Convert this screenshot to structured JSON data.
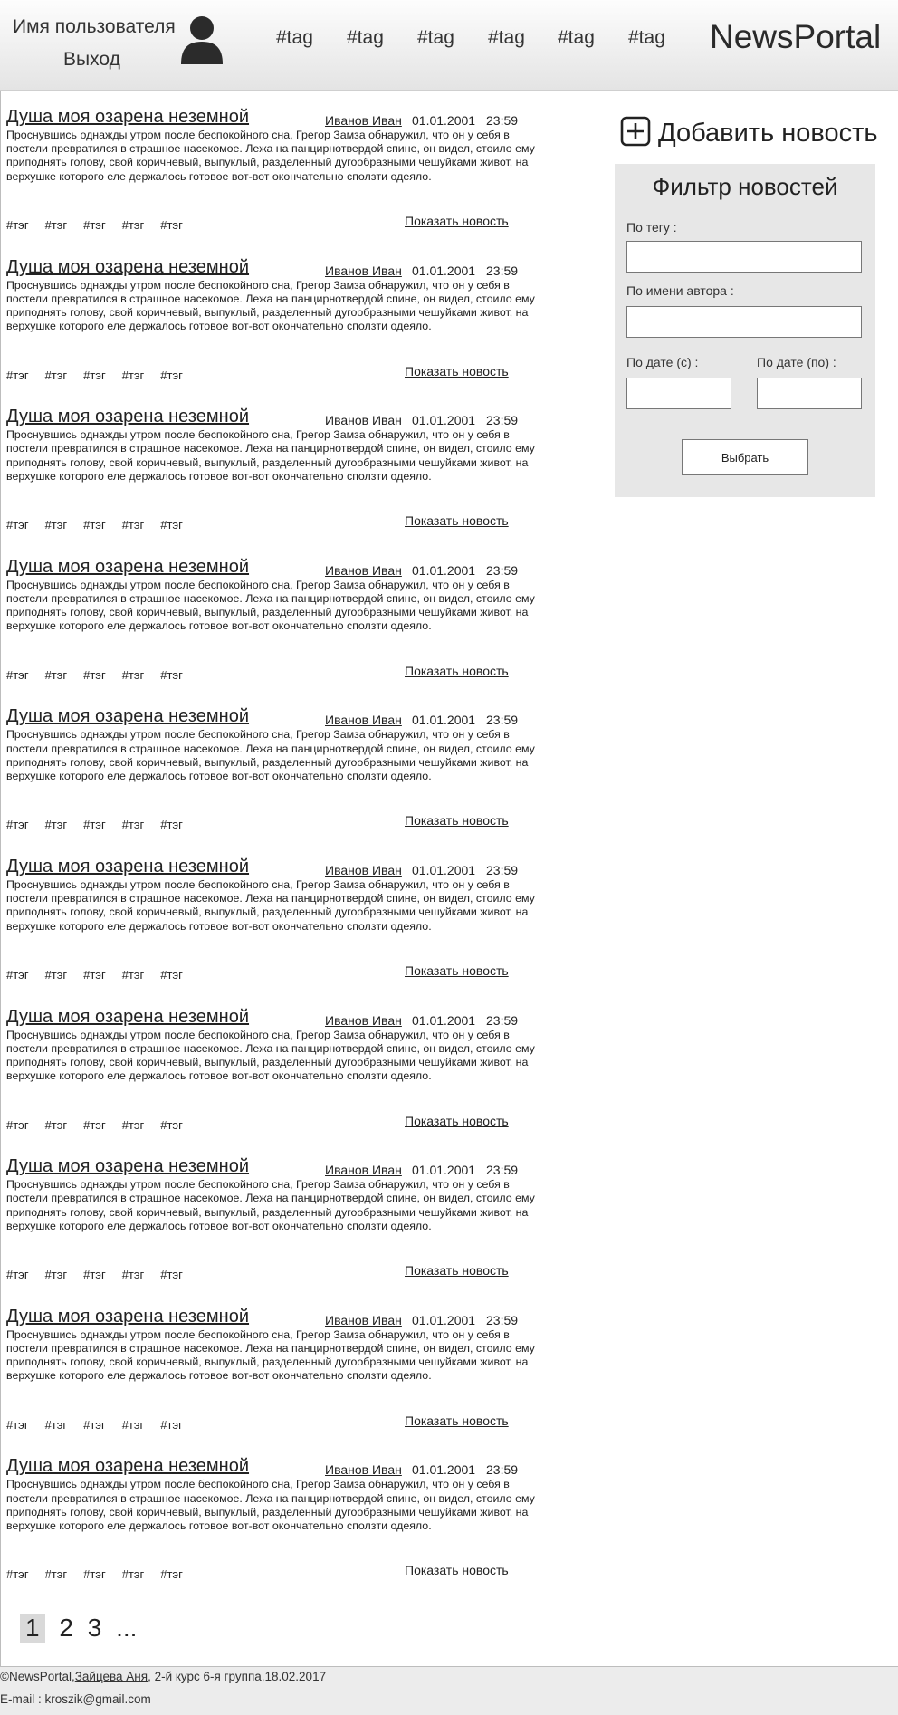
{
  "header": {
    "user_name": "Имя пользователя",
    "logout": "Выход",
    "nav_tags": [
      "#tag",
      "#tag",
      "#tag",
      "#tag",
      "#tag",
      "#tag"
    ],
    "brand": "NewsPortal"
  },
  "news": {
    "items": [
      {
        "title": "Душа моя озарена неземной",
        "author": "Иванов Иван",
        "date": "01.01.2001",
        "time": "23:59",
        "text": "Проснувшись однажды утром после беспокойного сна, Грегор Замза обнаружил, что он у себя в постели превратился в страшное насекомое. Лежа на панцирнотвердой спине, он видел, стоило ему приподнять голову, свой коричневый, выпуклый, разделенный дугообразными чешуйками живот, на верхушке которого еле держалось готовое вот-вот окончательно сползти одеяло.",
        "tags": [
          "#тэг",
          "#тэг",
          "#тэг",
          "#тэг",
          "#тэг"
        ],
        "show": "Показать новость"
      },
      {
        "title": "Душа моя озарена неземной",
        "author": "Иванов Иван",
        "date": "01.01.2001",
        "time": "23:59",
        "text": "Проснувшись однажды утром после беспокойного сна, Грегор Замза обнаружил, что он у себя в постели превратился в страшное насекомое. Лежа на панцирнотвердой спине, он видел, стоило ему приподнять голову, свой коричневый, выпуклый, разделенный дугообразными чешуйками живот, на верхушке которого еле держалось готовое вот-вот окончательно сползти одеяло.",
        "tags": [
          "#тэг",
          "#тэг",
          "#тэг",
          "#тэг",
          "#тэг"
        ],
        "show": "Показать новость"
      },
      {
        "title": "Душа моя озарена неземной",
        "author": "Иванов Иван",
        "date": "01.01.2001",
        "time": "23:59",
        "text": "Проснувшись однажды утром после беспокойного сна, Грегор Замза обнаружил, что он у себя в постели превратился в страшное насекомое. Лежа на панцирнотвердой спине, он видел, стоило ему приподнять голову, свой коричневый, выпуклый, разделенный дугообразными чешуйками живот, на верхушке которого еле держалось готовое вот-вот окончательно сползти одеяло.",
        "tags": [
          "#тэг",
          "#тэг",
          "#тэг",
          "#тэг",
          "#тэг"
        ],
        "show": "Показать новость"
      },
      {
        "title": "Душа моя озарена неземной",
        "author": "Иванов Иван",
        "date": "01.01.2001",
        "time": "23:59",
        "text": "Проснувшись однажды утром после беспокойного сна, Грегор Замза обнаружил, что он у себя в постели превратился в страшное насекомое. Лежа на панцирнотвердой спине, он видел, стоило ему приподнять голову, свой коричневый, выпуклый, разделенный дугообразными чешуйками живот, на верхушке которого еле держалось готовое вот-вот окончательно сползти одеяло.",
        "tags": [
          "#тэг",
          "#тэг",
          "#тэг",
          "#тэг",
          "#тэг"
        ],
        "show": "Показать новость"
      },
      {
        "title": "Душа моя озарена неземной",
        "author": "Иванов Иван",
        "date": "01.01.2001",
        "time": "23:59",
        "text": "Проснувшись однажды утром после беспокойного сна, Грегор Замза обнаружил, что он у себя в постели превратился в страшное насекомое. Лежа на панцирнотвердой спине, он видел, стоило ему приподнять голову, свой коричневый, выпуклый, разделенный дугообразными чешуйками живот, на верхушке которого еле держалось готовое вот-вот окончательно сползти одеяло.",
        "tags": [
          "#тэг",
          "#тэг",
          "#тэг",
          "#тэг",
          "#тэг"
        ],
        "show": "Показать новость"
      },
      {
        "title": "Душа моя озарена неземной",
        "author": "Иванов Иван",
        "date": "01.01.2001",
        "time": "23:59",
        "text": "Проснувшись однажды утром после беспокойного сна, Грегор Замза обнаружил, что он у себя в постели превратился в страшное насекомое. Лежа на панцирнотвердой спине, он видел, стоило ему приподнять голову, свой коричневый, выпуклый, разделенный дугообразными чешуйками живот, на верхушке которого еле держалось готовое вот-вот окончательно сползти одеяло.",
        "tags": [
          "#тэг",
          "#тэг",
          "#тэг",
          "#тэг",
          "#тэг"
        ],
        "show": "Показать новость"
      },
      {
        "title": "Душа моя озарена неземной",
        "author": "Иванов Иван",
        "date": "01.01.2001",
        "time": "23:59",
        "text": "Проснувшись однажды утром после беспокойного сна, Грегор Замза обнаружил, что он у себя в постели превратился в страшное насекомое. Лежа на панцирнотвердой спине, он видел, стоило ему приподнять голову, свой коричневый, выпуклый, разделенный дугообразными чешуйками живот, на верхушке которого еле держалось готовое вот-вот окончательно сползти одеяло.",
        "tags": [
          "#тэг",
          "#тэг",
          "#тэг",
          "#тэг",
          "#тэг"
        ],
        "show": "Показать новость"
      },
      {
        "title": "Душа моя озарена неземной",
        "author": "Иванов Иван",
        "date": "01.01.2001",
        "time": "23:59",
        "text": "Проснувшись однажды утром после беспокойного сна, Грегор Замза обнаружил, что он у себя в постели превратился в страшное насекомое. Лежа на панцирнотвердой спине, он видел, стоило ему приподнять голову, свой коричневый, выпуклый, разделенный дугообразными чешуйками живот, на верхушке которого еле держалось готовое вот-вот окончательно сползти одеяло.",
        "tags": [
          "#тэг",
          "#тэг",
          "#тэг",
          "#тэг",
          "#тэг"
        ],
        "show": "Показать новость"
      },
      {
        "title": "Душа моя озарена неземной",
        "author": "Иванов Иван",
        "date": "01.01.2001",
        "time": "23:59",
        "text": "Проснувшись однажды утром после беспокойного сна, Грегор Замза обнаружил, что он у себя в постели превратился в страшное насекомое. Лежа на панцирнотвердой спине, он видел, стоило ему приподнять голову, свой коричневый, выпуклый, разделенный дугообразными чешуйками живот, на верхушке которого еле держалось готовое вот-вот окончательно сползти одеяло.",
        "tags": [
          "#тэг",
          "#тэг",
          "#тэг",
          "#тэг",
          "#тэг"
        ],
        "show": "Показать новость"
      },
      {
        "title": "Душа моя озарена неземной",
        "author": "Иванов Иван",
        "date": "01.01.2001",
        "time": "23:59",
        "text": "Проснувшись однажды утром после беспокойного сна, Грегор Замза обнаружил, что он у себя в постели превратился в страшное насекомое. Лежа на панцирнотвердой спине, он видел, стоило ему приподнять голову, свой коричневый, выпуклый, разделенный дугообразными чешуйками живот, на верхушке которого еле держалось готовое вот-вот окончательно сползти одеяло.",
        "tags": [
          "#тэг",
          "#тэг",
          "#тэг",
          "#тэг",
          "#тэг"
        ],
        "show": "Показать новость"
      }
    ]
  },
  "pagination": {
    "pages": [
      "1",
      "2",
      "3"
    ],
    "more": "...",
    "active": "1"
  },
  "sidebar": {
    "add_news": "Добавить новость",
    "filter": {
      "title": "Фильтр новостей",
      "tag_label": "По тегу :",
      "tag_value": "",
      "author_label": "По имени автора :",
      "author_value": "",
      "date_from_label": "По дате (с) :",
      "date_from_value": "",
      "date_to_label": "По дате (по) :",
      "date_to_value": "",
      "submit": "Выбрать"
    }
  },
  "footer": {
    "prefix": "©NewsPortal,",
    "author_link": "Зайцева Аня",
    "suffix": ", 2-й курс 6-я группа,18.02.2017",
    "email": "E-mail : kroszik@gmail.com"
  },
  "icons": {
    "avatar": "user-avatar-icon",
    "add": "plus-square-icon"
  },
  "colors": {
    "header_gradient_top": "#fdfdfd",
    "header_gradient_bottom": "#e4e4e4",
    "filter_bg": "#e7e7e7",
    "footer_bg": "#ececec",
    "pager_active_bg": "#d9d9d9",
    "text": "#222222"
  }
}
